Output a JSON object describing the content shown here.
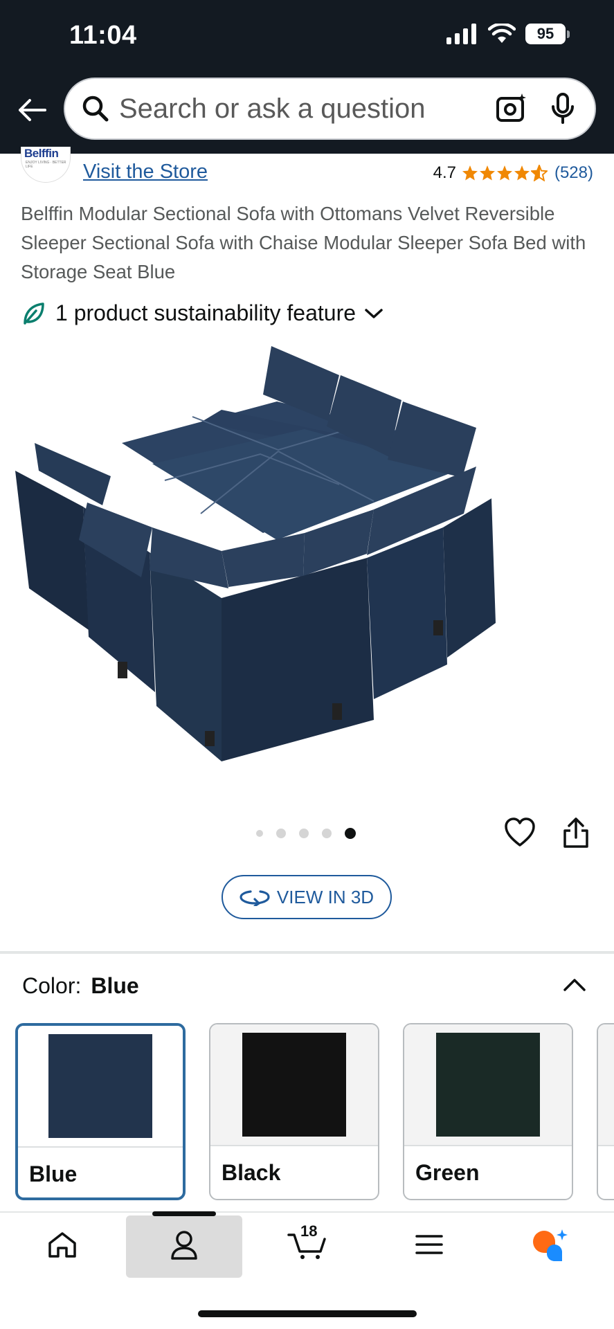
{
  "status_bar": {
    "time": "11:04",
    "battery": "95"
  },
  "search": {
    "placeholder": "Search or ask a question"
  },
  "store": {
    "logo_text": "Belffin",
    "logo_sub": "ENJOY LIVING · BETTER LIFE",
    "link": "Visit the Store"
  },
  "rating": {
    "value": "4.7",
    "stars": 4.7,
    "count": "(528)"
  },
  "product": {
    "title": "Belffin Modular Sectional Sofa with Ottomans Velvet Reversible Sleeper Sectional Sofa with Chaise Modular Sleeper Sofa Bed with Storage Seat Blue",
    "sustainability": "1 product sustainability feature"
  },
  "gallery": {
    "total_images": 5,
    "active_index": 4
  },
  "view3d": {
    "label": "VIEW IN 3D"
  },
  "color": {
    "label": "Color:",
    "selected": "Blue",
    "options": [
      {
        "name": "Blue",
        "hex": "#22344d"
      },
      {
        "name": "Black",
        "hex": "#121212"
      },
      {
        "name": "Green",
        "hex": "#1a2a26"
      }
    ]
  },
  "bottom_nav": {
    "items": [
      "home-icon",
      "account-icon",
      "cart-icon",
      "menu-icon",
      "rufus-icon"
    ],
    "active": "account-icon",
    "cart_count": "18"
  },
  "colors": {
    "header_bg": "#131a22",
    "link": "#1f5a9c",
    "star": "#f08804"
  }
}
